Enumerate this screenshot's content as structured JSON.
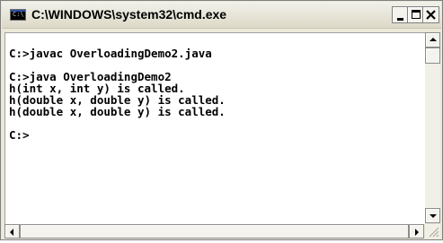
{
  "window": {
    "title": "C:\\WINDOWS\\system32\\cmd.exe",
    "icon": "cmd-console-icon",
    "icon_text": "C:\\"
  },
  "title_buttons": {
    "minimize": "minimize-icon",
    "maximize": "maximize-icon",
    "close": "close-icon"
  },
  "console": {
    "lines": [
      "C:>javac OverloadingDemo2.java",
      "",
      "C:>java OverloadingDemo2",
      "h(int x, int y) is called.",
      "h(double x, double y) is called.",
      "h(double x, double y) is called.",
      "",
      "C:>"
    ]
  },
  "colors": {
    "console_background": "#ffffff",
    "console_text": "#000000",
    "title_bar": "#ece9d8"
  }
}
